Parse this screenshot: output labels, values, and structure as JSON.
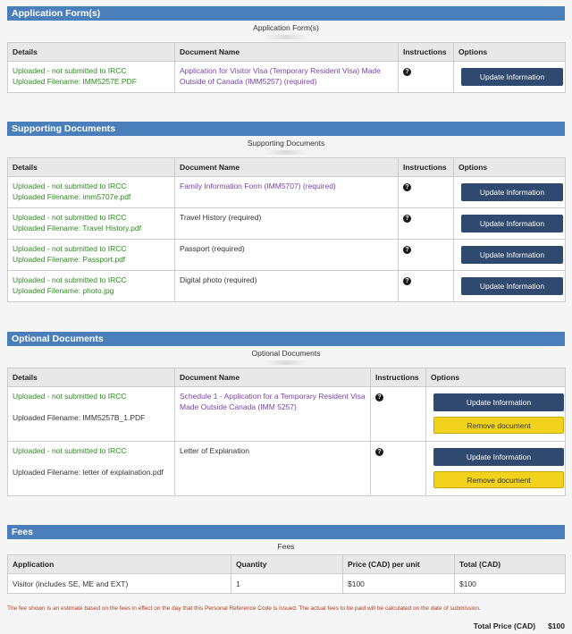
{
  "application_forms": {
    "heading": "Application Form(s)",
    "caption": "Application Form(s)",
    "columns": [
      "Details",
      "Document Name",
      "Instructions",
      "Options"
    ],
    "rows": [
      {
        "status": "Uploaded - not submitted to IRCC",
        "filename": "Uploaded Filename:  IMM5257E.PDF",
        "doc": "Application for Visitor Visa (Temporary Resident Visa) Made Outside of Canada (IMM5257)  (required)",
        "button": "Update Information"
      }
    ]
  },
  "supporting_documents": {
    "heading": "Supporting Documents",
    "caption": "Supporting Documents",
    "columns": [
      "Details",
      "Document Name",
      "Instructions",
      "Options"
    ],
    "rows": [
      {
        "status": "Uploaded - not submitted to IRCC",
        "filename": "Uploaded Filename:  imm5707e.pdf",
        "doc": "Family Information Form (IMM5707)  (required)",
        "button": "Update Information"
      },
      {
        "status": "Uploaded - not submitted to IRCC",
        "filename": "Uploaded Filename:  Travel History.pdf",
        "doc": "Travel History  (required)",
        "button": "Update Information"
      },
      {
        "status": "Uploaded - not submitted to IRCC",
        "filename": "Uploaded Filename:  Passport.pdf",
        "doc": "Passport  (required)",
        "button": "Update Information"
      },
      {
        "status": "Uploaded - not submitted to IRCC",
        "filename": "Uploaded Filename:  photo.jpg",
        "doc": "Digital photo  (required)",
        "button": "Update Information"
      }
    ]
  },
  "optional_documents": {
    "heading": "Optional Documents",
    "caption": "Optional Documents",
    "columns": [
      "Details",
      "Document Name",
      "Instructions",
      "Options"
    ],
    "rows": [
      {
        "status": "Uploaded - not submitted to IRCC",
        "filename": "Uploaded Filename:  IMM5257B_1.PDF",
        "doc": "Schedule 1 - Application for a Temporary Resident Visa Made Outside Canada (IMM 5257)",
        "button": "Update Information",
        "remove": "Remove document"
      },
      {
        "status": "Uploaded - not submitted to IRCC",
        "filename": "Uploaded Filename:  letter of explaination.pdf",
        "doc": "Letter of Explanation",
        "button": "Update Information",
        "remove": "Remove document"
      }
    ]
  },
  "fees": {
    "heading": "Fees",
    "caption": "Fees",
    "columns": [
      "Application",
      "Quantity",
      "Price (CAD) per unit",
      "Total (CAD)"
    ],
    "rows": [
      {
        "application": "Visitor (includes SE, ME and EXT)",
        "quantity": "1",
        "price": "$100",
        "total": "$100"
      }
    ],
    "note": "The fee shown is an estimate based on the fees in effect on the day that this Personal Reference Code is issued. The actual fees to be paid will be calculated on the date of submission.",
    "total_label": "Total Price (CAD)",
    "total_value": "$100"
  },
  "icons": {
    "info": "question-circle-icon",
    "info_glyph": "?"
  },
  "colors": {
    "header_blue": "#4a7fbc",
    "button_navy": "#2f4a6e",
    "remove_yellow": "#f3d21e",
    "status_green": "#2e8b20",
    "link_purple": "#7a44a8",
    "note_red": "#b53a1c"
  }
}
